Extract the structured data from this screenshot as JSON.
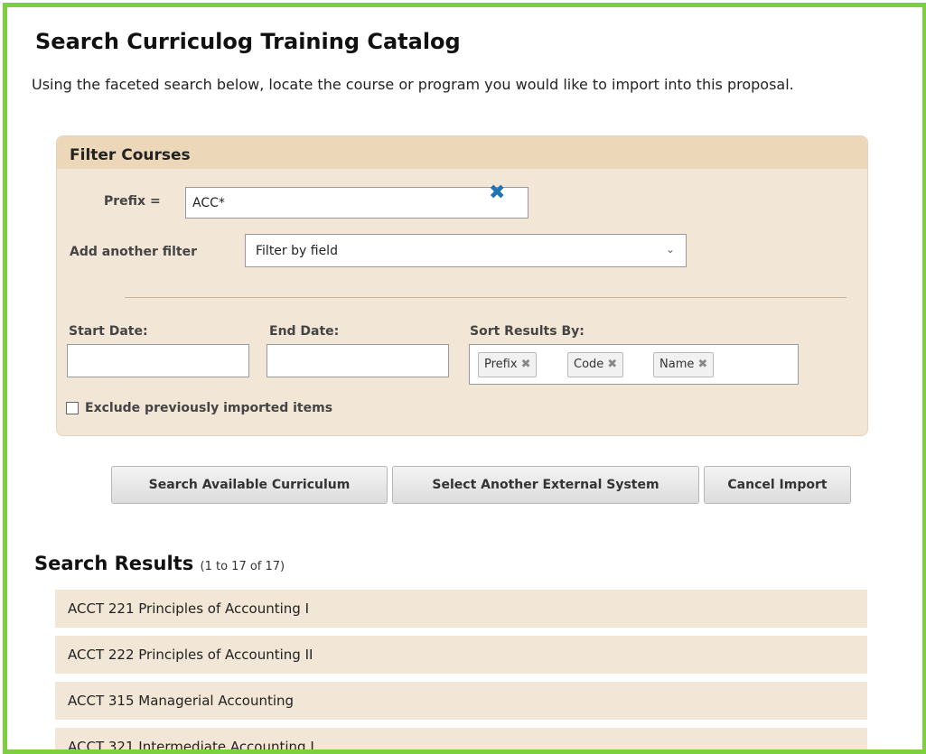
{
  "page": {
    "title": "Search Curriculog Training Catalog",
    "intro": "Using the faceted search below, locate the course or program you would like to import into this proposal."
  },
  "filter": {
    "title": "Filter Courses",
    "prefix_label": "Prefix =",
    "prefix_value": "ACC*",
    "add_filter_label": "Add another filter",
    "add_filter_selected": "Filter by field",
    "start_date_label": "Start Date:",
    "start_date_value": "",
    "end_date_label": "End Date:",
    "end_date_value": "",
    "sort_label": "Sort Results By:",
    "sort_chips": [
      "Prefix",
      "Code",
      "Name"
    ],
    "exclude_label": "Exclude previously imported items",
    "exclude_checked": false
  },
  "buttons": {
    "search": "Search Available Curriculum",
    "select_system": "Select Another External System",
    "cancel": "Cancel Import"
  },
  "results": {
    "title": "Search Results",
    "count": "(1 to 17 of 17)",
    "items": [
      "ACCT 221 Principles of Accounting I",
      "ACCT 222 Principles of Accounting II",
      "ACCT 315 Managerial Accounting",
      "ACCT 321 Intermediate Accounting I"
    ]
  },
  "colors": {
    "frame": "#7ccf3e",
    "panel": "#f2e6d6",
    "panel_header": "#ecd8b8",
    "clear_icon": "#1f73b7"
  },
  "icons": {
    "clear_prefix": "close-icon",
    "select_arrow": "chevron-down-icon",
    "chip_remove": "close-icon"
  }
}
